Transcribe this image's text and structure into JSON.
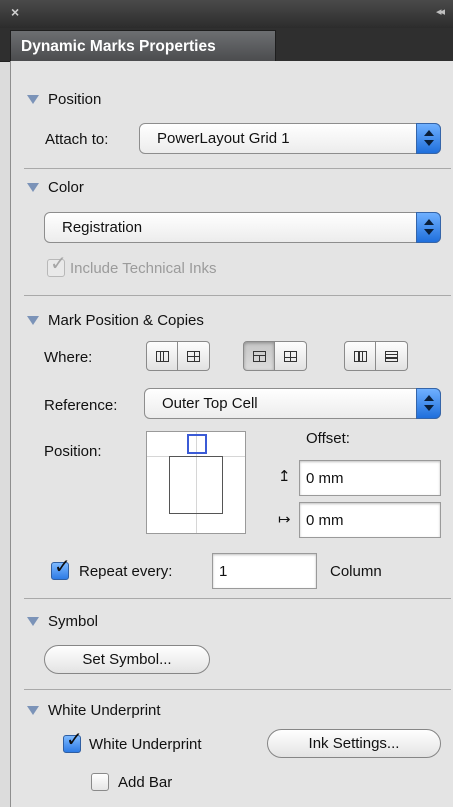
{
  "titlebar": {
    "close_glyph": "×",
    "collapse_glyph": "◂◂"
  },
  "tab": {
    "title": "Dynamic Marks Properties"
  },
  "position": {
    "heading": "Position",
    "attach_label": "Attach to:",
    "attach_value": "PowerLayout Grid 1"
  },
  "color": {
    "heading": "Color",
    "value": "Registration",
    "include_inks_label": "Include Technical Inks",
    "include_inks_checked": true,
    "include_inks_enabled": false
  },
  "mark": {
    "heading": "Mark Position & Copies",
    "where_label": "Where:",
    "where_selected_index": 2,
    "reference_label": "Reference:",
    "reference_value": "Outer Top Cell",
    "position_label": "Position:",
    "offset_label": "Offset:",
    "offset_y_icon": "↥",
    "offset_y_value": "0 mm",
    "offset_x_icon": "↦",
    "offset_x_value": "0 mm",
    "repeat_label": "Repeat every:",
    "repeat_checked": true,
    "repeat_value": "1",
    "repeat_unit": "Column"
  },
  "symbol": {
    "heading": "Symbol",
    "set_button": "Set Symbol..."
  },
  "underprint": {
    "heading": "White Underprint",
    "checkbox_label": "White Underprint",
    "checkbox_checked": true,
    "ink_button": "Ink Settings...",
    "add_bar_label": "Add Bar",
    "add_bar_checked": false
  },
  "colors": {
    "accent": "#2e7be5",
    "section_triangle": "#7b93b8",
    "title_bar": "#2f2f2f"
  }
}
